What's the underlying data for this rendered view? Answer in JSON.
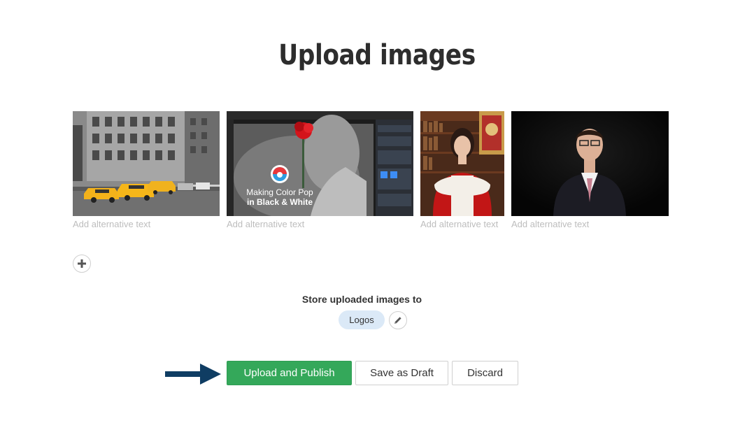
{
  "page": {
    "title": "Upload images"
  },
  "images": [
    {
      "alt_placeholder": "Add alternative text",
      "subject": "taxi-street-photo"
    },
    {
      "alt_placeholder": "Add alternative text",
      "subject": "color-pop-tutorial",
      "overlay_line1": "Making Color Pop",
      "overlay_line2": "in Black & White"
    },
    {
      "alt_placeholder": "Add alternative text",
      "subject": "judge-portrait"
    },
    {
      "alt_placeholder": "Add alternative text",
      "subject": "man-portrait"
    }
  ],
  "storage": {
    "label": "Store uploaded images to",
    "folder": "Logos"
  },
  "actions": {
    "publish_label": "Upload and Publish",
    "draft_label": "Save as Draft",
    "discard_label": "Discard"
  },
  "colors": {
    "primary": "#34a85a",
    "chip": "#dbe9f7",
    "arrow": "#0f3d63"
  },
  "icons": {
    "add": "plus-icon",
    "edit": "pencil-icon",
    "pointer": "arrow-right-icon"
  }
}
